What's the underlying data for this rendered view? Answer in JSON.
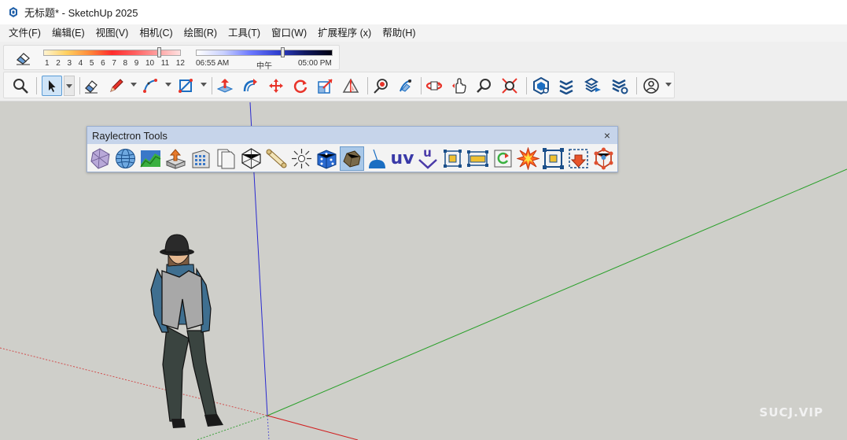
{
  "window": {
    "title": "无标题* - SketchUp 2025"
  },
  "menu": {
    "items": [
      "文件(F)",
      "编辑(E)",
      "视图(V)",
      "相机(C)",
      "绘图(R)",
      "工具(T)",
      "窗口(W)",
      "扩展程序 (x)",
      "帮助(H)"
    ]
  },
  "shadows": {
    "month_ticks": [
      "1",
      "2",
      "3",
      "4",
      "5",
      "6",
      "7",
      "8",
      "9",
      "10",
      "11",
      "12"
    ],
    "time_start": "06:55 AM",
    "time_mid": "中午",
    "time_end": "05:00 PM",
    "month_slider_fraction": 0.84,
    "time_slider_fraction": 0.63
  },
  "main_toolbar": {
    "icons": [
      "zoom-icon",
      "select-icon",
      "eraser-icon",
      "pencil-icon",
      "arc-icon",
      "rectangle-icon",
      "push-pull-icon",
      "follow-me-icon",
      "move-icon",
      "rotate-icon",
      "scale-icon",
      "section-plane-icon",
      "position-camera-icon",
      "walk-icon",
      "orbit-icon",
      "pan-icon",
      "zoom-tool-icon",
      "zoom-extents-icon",
      "components-icon",
      "layers-icon",
      "styles-icon",
      "tags-icon",
      "account-icon"
    ]
  },
  "raylectron": {
    "title": "Raylectron Tools",
    "close": "×",
    "uv_label": "uv",
    "u_label": "u"
  },
  "watermark": "SUCJ.VIP",
  "colors": {
    "accent_blue": "#1b6ec2",
    "red": "#e8342a",
    "viewport": "#cfcfca"
  }
}
